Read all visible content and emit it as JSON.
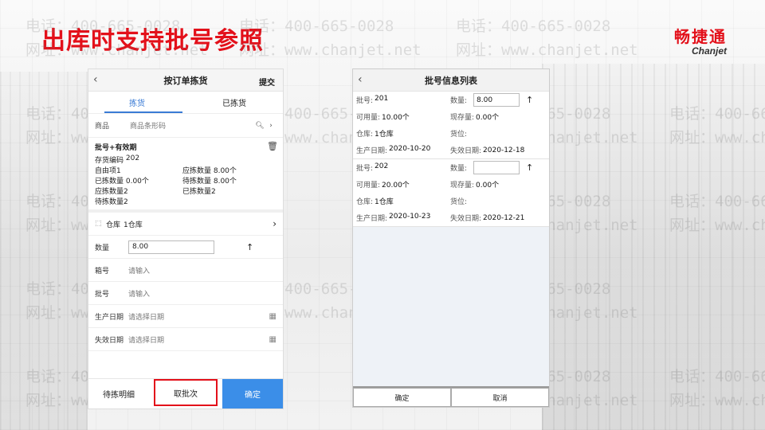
{
  "slide": {
    "title": "出库时支持批号参照",
    "logo_cn": "畅捷通",
    "logo_en": "Chanjet",
    "watermark_phone": "电话：400-665-0028",
    "watermark_site": "网址：www.chanjet.net"
  },
  "phone1": {
    "header": {
      "back_icon": "chevron-left-icon",
      "title": "按订单拣货",
      "submit": "提交"
    },
    "tabs": [
      "拣货",
      "已拣货"
    ],
    "search": {
      "label": "商品",
      "placeholder": "商品条形码"
    },
    "item": {
      "heading": "批号+有效期",
      "code_label": "存货编码",
      "code": "202",
      "lines": [
        [
          "自由项1",
          "应拣数量 8.00个"
        ],
        [
          "已拣数量 0.00个",
          "待拣数量 8.00个"
        ],
        [
          "应拣数量2",
          "已拣数量2"
        ],
        [
          "待拣数量2",
          ""
        ]
      ]
    },
    "warehouse": {
      "label": "仓库",
      "value": "1仓库"
    },
    "quantity": {
      "label": "数量",
      "value": "8.00"
    },
    "box": {
      "label": "箱号",
      "placeholder": "请输入"
    },
    "batch": {
      "label": "批号",
      "placeholder": "请输入"
    },
    "prod_date": {
      "label": "生产日期",
      "placeholder": "请选择日期"
    },
    "exp_date": {
      "label": "失效日期",
      "placeholder": "请选择日期"
    },
    "footer": {
      "detail": "待拣明细",
      "take_batch": "取批次",
      "confirm": "确定"
    }
  },
  "phone2": {
    "header": {
      "title": "批号信息列表"
    },
    "batches": [
      {
        "batch_label": "批号:",
        "batch": "201",
        "qty_label": "数量:",
        "qty": "8.00",
        "avail_label": "可用量:",
        "avail": "10.00个",
        "stock_label": "现存量:",
        "stock": "0.00个",
        "wh_label": "仓库:",
        "wh": "1仓库",
        "loc_label": "货位:",
        "loc": "",
        "prod_label": "生产日期:",
        "prod": "2020-10-20",
        "exp_label": "失效日期:",
        "exp": "2020-12-18"
      },
      {
        "batch_label": "批号:",
        "batch": "202",
        "qty_label": "数量:",
        "qty": "",
        "avail_label": "可用量:",
        "avail": "20.00个",
        "stock_label": "现存量:",
        "stock": "0.00个",
        "wh_label": "仓库:",
        "wh": "1仓库",
        "loc_label": "货位:",
        "loc": "",
        "prod_label": "生产日期:",
        "prod": "2020-10-23",
        "exp_label": "失效日期:",
        "exp": "2020-12-21"
      }
    ],
    "footer": {
      "confirm": "确定",
      "cancel": "取消"
    }
  },
  "colors": {
    "accent_red": "#e3101a",
    "tab_blue": "#3a7bd5",
    "button_blue": "#3b8ee8"
  }
}
